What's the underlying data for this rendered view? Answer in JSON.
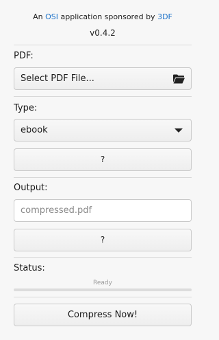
{
  "header": {
    "prefix": "An",
    "osi_link": "OSI",
    "middle": "application sponsored by",
    "sponsor_link": "3DF",
    "version": "v0.4.2"
  },
  "pdf": {
    "label": "PDF:",
    "select_button": "Select PDF File...",
    "icon": "folder-open-icon"
  },
  "type": {
    "label": "Type:",
    "selected": "ebook",
    "help_button": "?"
  },
  "output": {
    "label": "Output:",
    "placeholder": "compressed.pdf",
    "help_button": "?"
  },
  "status": {
    "label": "Status:",
    "text": "Ready",
    "progress": 0
  },
  "actions": {
    "compress_button": "Compress Now!"
  },
  "colors": {
    "link": "#1c72c9",
    "background": "#f7f7f7"
  }
}
